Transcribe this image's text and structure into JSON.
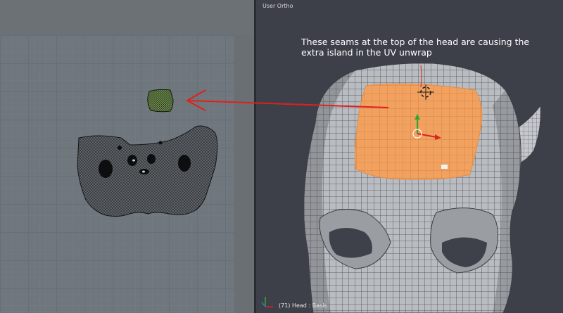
{
  "uv_editor": {
    "islands": [
      "main-face-island",
      "extra-seam-island"
    ]
  },
  "viewport": {
    "view_label": "User Ortho",
    "status": "(71) Head : Basis",
    "selection_color": "#f5a15c",
    "mesh_color": "#b9bcc1"
  },
  "annotation": {
    "text": "These seams at the top of the head are causing the extra island in the UV unwrap",
    "arrow_color": "#e0201c"
  }
}
